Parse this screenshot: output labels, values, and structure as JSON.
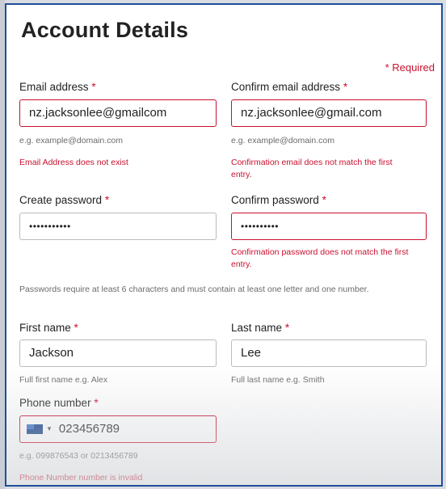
{
  "form": {
    "title": "Account Details",
    "required_note": "* Required",
    "email": {
      "label": "Email address",
      "value": "nz.jacksonlee@gmailcom",
      "hint": "e.g. example@domain.com",
      "error": "Email Address does not exist"
    },
    "confirm_email": {
      "label": "Confirm email address",
      "value": "nz.jacksonlee@gmail.com",
      "hint": "e.g. example@domain.com",
      "error_line1": "Confirmation email does not match the first",
      "error_line2": "entry."
    },
    "password": {
      "label": "Create password",
      "value": "•••••••••••"
    },
    "confirm_password": {
      "label": "Confirm password",
      "value": "••••••••••",
      "error_line1": "Confirmation password does not match the first",
      "error_line2": "entry."
    },
    "password_note": "Passwords require at least 6 characters and must contain at least one letter and one number.",
    "first_name": {
      "label": "First name",
      "value": "Jackson",
      "hint": "Full first name e.g. Alex"
    },
    "last_name": {
      "label": "Last name",
      "value": "Lee",
      "hint": "Full last name e.g. Smith"
    },
    "phone": {
      "label": "Phone number",
      "value": "023456789",
      "country_icon": "nz-flag-icon",
      "hint": "e.g. 099876543 or 0213456789",
      "error": "Phone Number number is invalid"
    },
    "required_star": "*"
  },
  "colors": {
    "error": "#c8102e",
    "frame": "#1f4e9a"
  }
}
